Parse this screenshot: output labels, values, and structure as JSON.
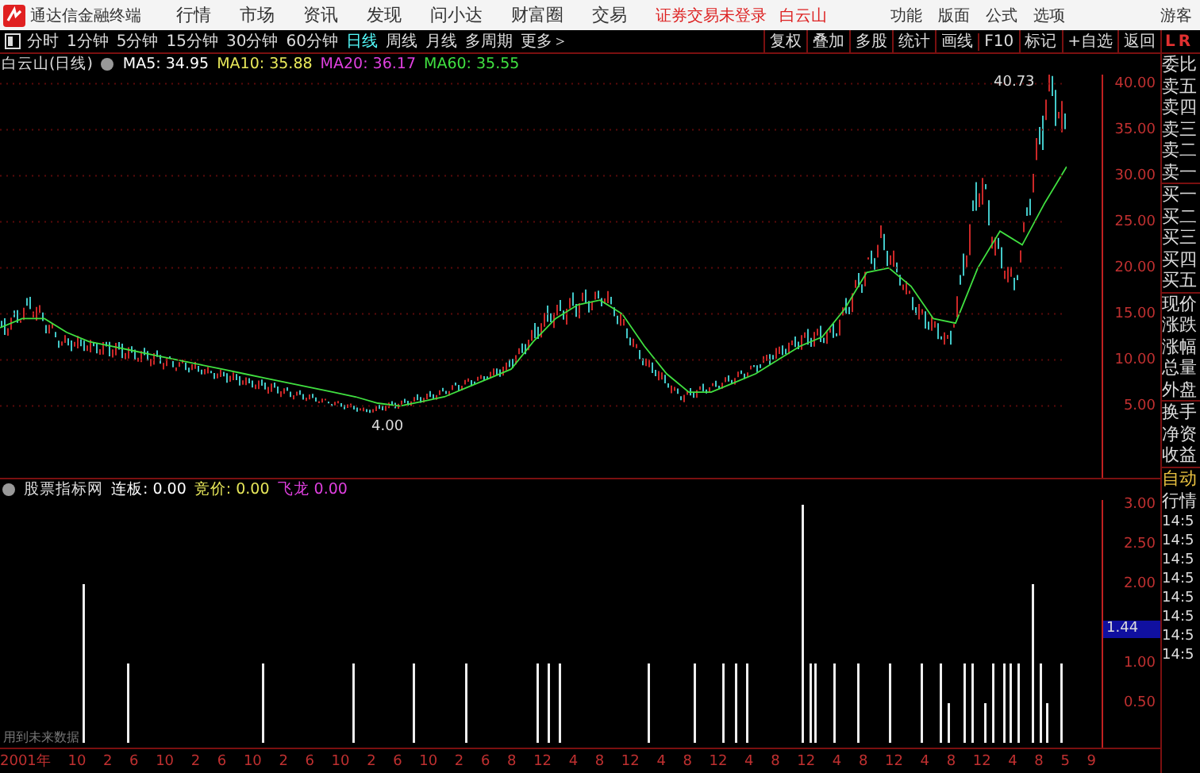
{
  "app": {
    "title": "通达信金融终端"
  },
  "menu": [
    "行情",
    "市场",
    "资讯",
    "发现",
    "问小达",
    "财富圈",
    "交易"
  ],
  "login_status": "证券交易未登录",
  "stock_link": "白云山",
  "tools": [
    "功能",
    "版面",
    "公式",
    "选项"
  ],
  "user": "游客",
  "periods": [
    {
      "label": "分时",
      "selected": false
    },
    {
      "label": "1分钟",
      "selected": false
    },
    {
      "label": "5分钟",
      "selected": false
    },
    {
      "label": "15分钟",
      "selected": false
    },
    {
      "label": "30分钟",
      "selected": false
    },
    {
      "label": "60分钟",
      "selected": false
    },
    {
      "label": "日线",
      "selected": true
    },
    {
      "label": "周线",
      "selected": false
    },
    {
      "label": "月线",
      "selected": false
    },
    {
      "label": "多周期",
      "selected": false
    },
    {
      "label": "更多＞",
      "selected": false
    }
  ],
  "chart_buttons": [
    "复权",
    "叠加",
    "多股",
    "统计",
    "画线",
    "F10",
    "标记",
    "+自选",
    "返回"
  ],
  "side_header": [
    "L",
    "R"
  ],
  "price_panel": {
    "title": "白云山(日线)",
    "mas": [
      {
        "label": "MA5: 34.95",
        "color": "#ffffff"
      },
      {
        "label": "MA10: 35.88",
        "color": "#e8e85a"
      },
      {
        "label": "MA20: 36.17",
        "color": "#e040e0"
      },
      {
        "label": "MA60: 35.55",
        "color": "#40e040"
      }
    ],
    "high_marker": "40.73",
    "low_marker": "4.00",
    "chart_data": {
      "type": "line",
      "grid": true,
      "ylim": [
        -2.8,
        41
      ],
      "yticks": [
        {
          "value": 40,
          "label": "40.00"
        },
        {
          "value": 35,
          "label": "35.00"
        },
        {
          "value": 30,
          "label": "30.00"
        },
        {
          "value": 25,
          "label": "25.00"
        },
        {
          "value": 20,
          "label": "20.00"
        },
        {
          "value": 15,
          "label": "15.00"
        },
        {
          "value": 10,
          "label": "10.00"
        },
        {
          "value": 5,
          "label": "5.00"
        }
      ],
      "series": [
        {
          "color": "#40e040",
          "values": [
            13.5,
            14.5,
            14.5,
            13,
            12,
            11.5,
            11,
            10.5,
            10,
            9.5,
            9,
            8.5,
            8,
            7.5,
            7,
            6.5,
            6,
            5.3,
            5,
            5.5,
            6,
            7,
            8,
            9,
            12,
            14.5,
            16,
            16.5,
            15,
            11.5,
            8.5,
            6.5,
            6.5,
            7.5,
            8.5,
            10,
            11.5,
            12.5,
            15.5,
            19.5,
            20,
            18,
            14.5,
            14,
            20,
            24,
            22.5,
            27,
            31
          ]
        }
      ]
    }
  },
  "quote_labels": [
    "委比",
    "卖五",
    "卖四",
    "卖三",
    "卖二",
    "卖一",
    "买一",
    "买二",
    "买三",
    "买四",
    "买五",
    "现价",
    "涨跌",
    "涨幅",
    "总量",
    "外盘",
    "换手",
    "净资",
    "收益"
  ],
  "indicator_panel": {
    "title": "股票指标网",
    "values": [
      {
        "label": "连板: 0.00",
        "color": "#ffffff"
      },
      {
        "label": "竞价: 0.00",
        "color": "#e8e85a"
      },
      {
        "label": "飞龙 0.00",
        "color": "#e040e0"
      }
    ],
    "y_labels": [
      "3.00",
      "2.50",
      "2.00",
      "1.00",
      "0.50"
    ],
    "cursor_value": "1.44",
    "note": "用到未来数据"
  },
  "side_bottom": {
    "mode": "自动",
    "tab": "行情",
    "times": [
      "14:5",
      "14:5",
      "14:5",
      "14:5",
      "14:5",
      "14:5",
      "14:5",
      "14:5"
    ]
  },
  "x_axis": [
    "2001年",
    "10",
    "2",
    "6",
    "10",
    "2",
    "6",
    "10",
    "2",
    "6",
    "10",
    "2",
    "6",
    "10",
    "2",
    "6",
    "8",
    "12",
    "4",
    "8",
    "12",
    "4",
    "8",
    "12",
    "4",
    "8",
    "12",
    "4",
    "8",
    "12",
    "4",
    "8",
    "12",
    "4",
    "8",
    "5",
    "9"
  ]
}
